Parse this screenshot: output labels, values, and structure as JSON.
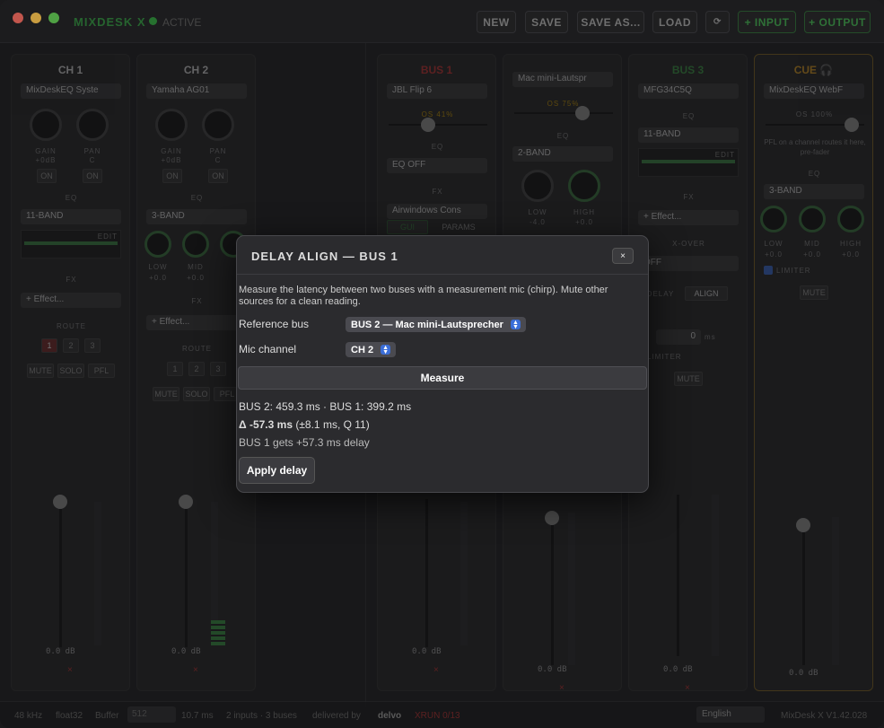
{
  "titlebar": {
    "app_title": "MIXDESK X",
    "status": "ACTIVE",
    "buttons": [
      "NEW",
      "SAVE",
      "SAVE AS...",
      "LOAD",
      "⟳",
      "+ INPUT",
      "+ OUTPUT"
    ]
  },
  "strips": {
    "ch1": {
      "name": "CH 1",
      "device": "MixDeskEQ Syste",
      "gain": "GAIN",
      "gain_val": "+0dB",
      "pan": "PAN",
      "pan_val": "C",
      "on": "ON",
      "eq": "EQ",
      "eq_mode": "11-BAND",
      "edit": "EDIT",
      "fx": "FX",
      "effect": "+ Effect...",
      "route": "ROUTE",
      "routes": [
        "1",
        "2",
        "3"
      ],
      "mute": "MUTE",
      "solo": "SOLO",
      "pfl": "PFL",
      "db": "0.0 dB",
      "x": "×"
    },
    "ch2": {
      "name": "CH 2",
      "device": "Yamaha AG01",
      "gain": "GAIN",
      "gain_val": "+0dB",
      "pan": "PAN",
      "pan_val": "C",
      "on": "ON",
      "eq": "EQ",
      "eq_mode": "3-BAND",
      "low": "LOW",
      "mid": "MID",
      "low_val": "+0.0",
      "mid_val": "+0.0",
      "fx": "FX",
      "effect": "+ Effect...",
      "route": "ROUTE",
      "routes": [
        "1",
        "2",
        "3"
      ],
      "mute": "MUTE",
      "solo": "SOLO",
      "pfl": "PFL",
      "db": "0.0 dB",
      "x": "×"
    },
    "bus1": {
      "name": "BUS 1",
      "device": "JBL Flip 6",
      "os": "OS 41%",
      "eq": "EQ",
      "eq_mode": "EQ OFF",
      "fx": "FX",
      "effect": "Airwindows Cons",
      "gui": "GUI",
      "params": "PARAMS",
      "db": "0.0 dB",
      "x": "×"
    },
    "bus2": {
      "device": "Mac mini-Lautspr",
      "os": "OS 75%",
      "eq": "EQ",
      "eq_mode": "2-BAND",
      "low": "LOW",
      "high": "HIGH",
      "low_val": "-4.0",
      "high_val": "+0.0",
      "db": "0.0 dB",
      "x": "×"
    },
    "bus3": {
      "name": "BUS 3",
      "device": "MFG34C5Q",
      "eq": "EQ",
      "eq_mode": "11-BAND",
      "edit": "EDIT",
      "fx": "FX",
      "effect": "+ Effect...",
      "xover": "X-OVER",
      "xover_val": "OFF",
      "delay": "DELAY",
      "align": "ALIGN",
      "delay_val": "0",
      "ms": "ms",
      "limiter": "LIMITER",
      "mute": "MUTE",
      "db": "0.0 dB",
      "x": "×"
    },
    "cue": {
      "name": "CUE 🎧",
      "device": "MixDeskEQ WebF",
      "os": "OS 100%",
      "note": "PFL on a channel routes it here, pre-fader",
      "eq": "EQ",
      "eq_mode": "3-BAND",
      "low": "LOW",
      "mid": "MID",
      "high": "HIGH",
      "low_val": "+0.0",
      "mid_val": "+0.0",
      "high_val": "+0.0",
      "limiter": "LIMITER",
      "mute": "MUTE",
      "db": "0.0 dB"
    }
  },
  "statusbar": {
    "rate": "48 kHz",
    "format": "float32",
    "buffer_label": "Buffer",
    "buffer_val": "512",
    "latency": "10.7 ms",
    "io": "2 inputs · 3 buses",
    "delivered": "delivered by",
    "brand": "delvo",
    "xrun": "XRUN 0/13",
    "language": "English",
    "version": "MixDesk X V1.42.028"
  },
  "modal": {
    "title": "DELAY ALIGN — BUS 1",
    "close": "×",
    "description": "Measure the latency between two buses with a measurement mic (chirp). Mute other sources for a clean reading.",
    "reference_label": "Reference bus",
    "reference_value": "BUS 2 — Mac mini-Lautsprecher",
    "mic_label": "Mic channel",
    "mic_value": "CH 2",
    "measure_button": "Measure",
    "result_line": "BUS 2: 459.3 ms · BUS 1: 399.2 ms",
    "delta_value": "Δ -57.3 ms",
    "delta_detail": "(±8.1 ms, Q 11)",
    "advice": "BUS 1 gets +57.3 ms delay",
    "apply_button": "Apply delay"
  }
}
